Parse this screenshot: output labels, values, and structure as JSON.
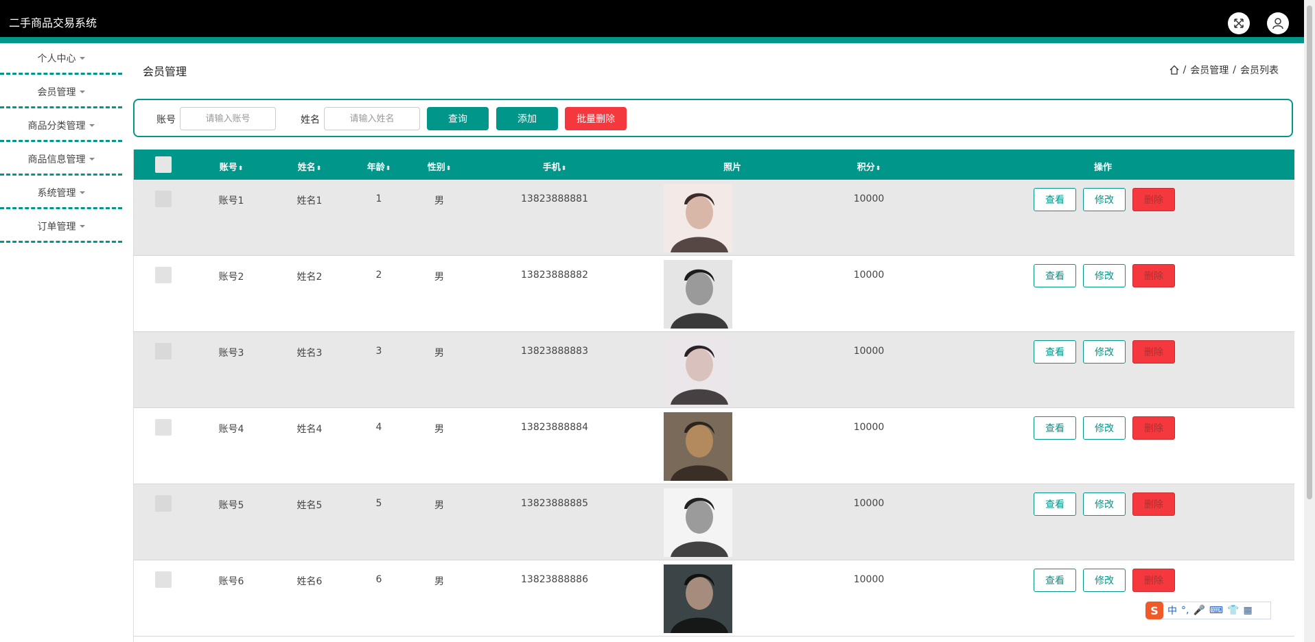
{
  "app": {
    "title": "二手商品交易系统"
  },
  "colors": {
    "accent": "#00968a",
    "danger": "#f5383d",
    "topbar": "#000000"
  },
  "header_icons": [
    "fullscreen-icon",
    "user-icon"
  ],
  "sidebar": {
    "items": [
      {
        "label": "个人中心"
      },
      {
        "label": "会员管理"
      },
      {
        "label": "商品分类管理"
      },
      {
        "label": "商品信息管理"
      },
      {
        "label": "系统管理"
      },
      {
        "label": "订单管理"
      }
    ]
  },
  "page": {
    "title": "会员管理",
    "breadcrumb": [
      "会员管理",
      "会员列表"
    ],
    "separator": "/"
  },
  "search": {
    "account_label": "账号",
    "account_placeholder": "请输入账号",
    "name_label": "姓名",
    "name_placeholder": "请输入姓名",
    "query_button": "查询",
    "add_button": "添加",
    "batch_delete_button": "批量删除"
  },
  "table": {
    "columns": [
      "账号",
      "姓名",
      "年龄",
      "性别",
      "手机",
      "照片",
      "积分",
      "操作"
    ],
    "actions": {
      "view": "查看",
      "edit": "修改",
      "delete": "删除"
    },
    "rows": [
      {
        "account": "账号1",
        "name": "姓名1",
        "age": "1",
        "gender": "男",
        "phone": "13823888881",
        "points": "10000"
      },
      {
        "account": "账号2",
        "name": "姓名2",
        "age": "2",
        "gender": "男",
        "phone": "13823888882",
        "points": "10000"
      },
      {
        "account": "账号3",
        "name": "姓名3",
        "age": "3",
        "gender": "男",
        "phone": "13823888883",
        "points": "10000"
      },
      {
        "account": "账号4",
        "name": "姓名4",
        "age": "4",
        "gender": "男",
        "phone": "13823888884",
        "points": "10000"
      },
      {
        "account": "账号5",
        "name": "姓名5",
        "age": "5",
        "gender": "男",
        "phone": "13823888885",
        "points": "10000"
      },
      {
        "account": "账号6",
        "name": "姓名6",
        "age": "6",
        "gender": "男",
        "phone": "13823888886",
        "points": "10000"
      }
    ]
  },
  "ime": {
    "logo": "S",
    "mode": "中",
    "punct": "°,"
  }
}
